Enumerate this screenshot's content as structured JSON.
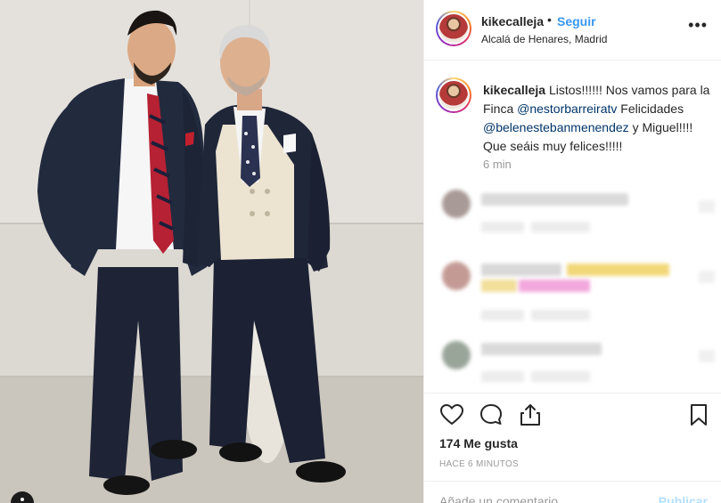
{
  "post": {
    "username": "kikecalleja",
    "separator": "•",
    "follow_label": "Seguir",
    "location": "Alcalá de Henares, Madrid",
    "more_label": "•••"
  },
  "caption": {
    "username": "kikecalleja",
    "text_1": "Listos!!!!!! Nos vamos para la Finca",
    "mention_1": "@nestorbarreiratv",
    "text_2": "Felicidades",
    "mention_2": "@belenestebanmenendez",
    "text_3": "y Miguel!!!! Que seáis muy felices!!!!!",
    "time": "6 min"
  },
  "engagement": {
    "likes": "174 Me gusta",
    "time_ago": "HACE 6 MINUTOS"
  },
  "add_comment": {
    "placeholder": "Añade un comentario...",
    "post_label": "Publicar"
  },
  "icons": {
    "like": "heart-icon",
    "comment": "comment-icon",
    "share": "share-icon",
    "save": "bookmark-icon"
  },
  "colors": {
    "link_blue": "#3897f0",
    "mention": "#003569",
    "muted": "#999999",
    "text": "#262626"
  }
}
